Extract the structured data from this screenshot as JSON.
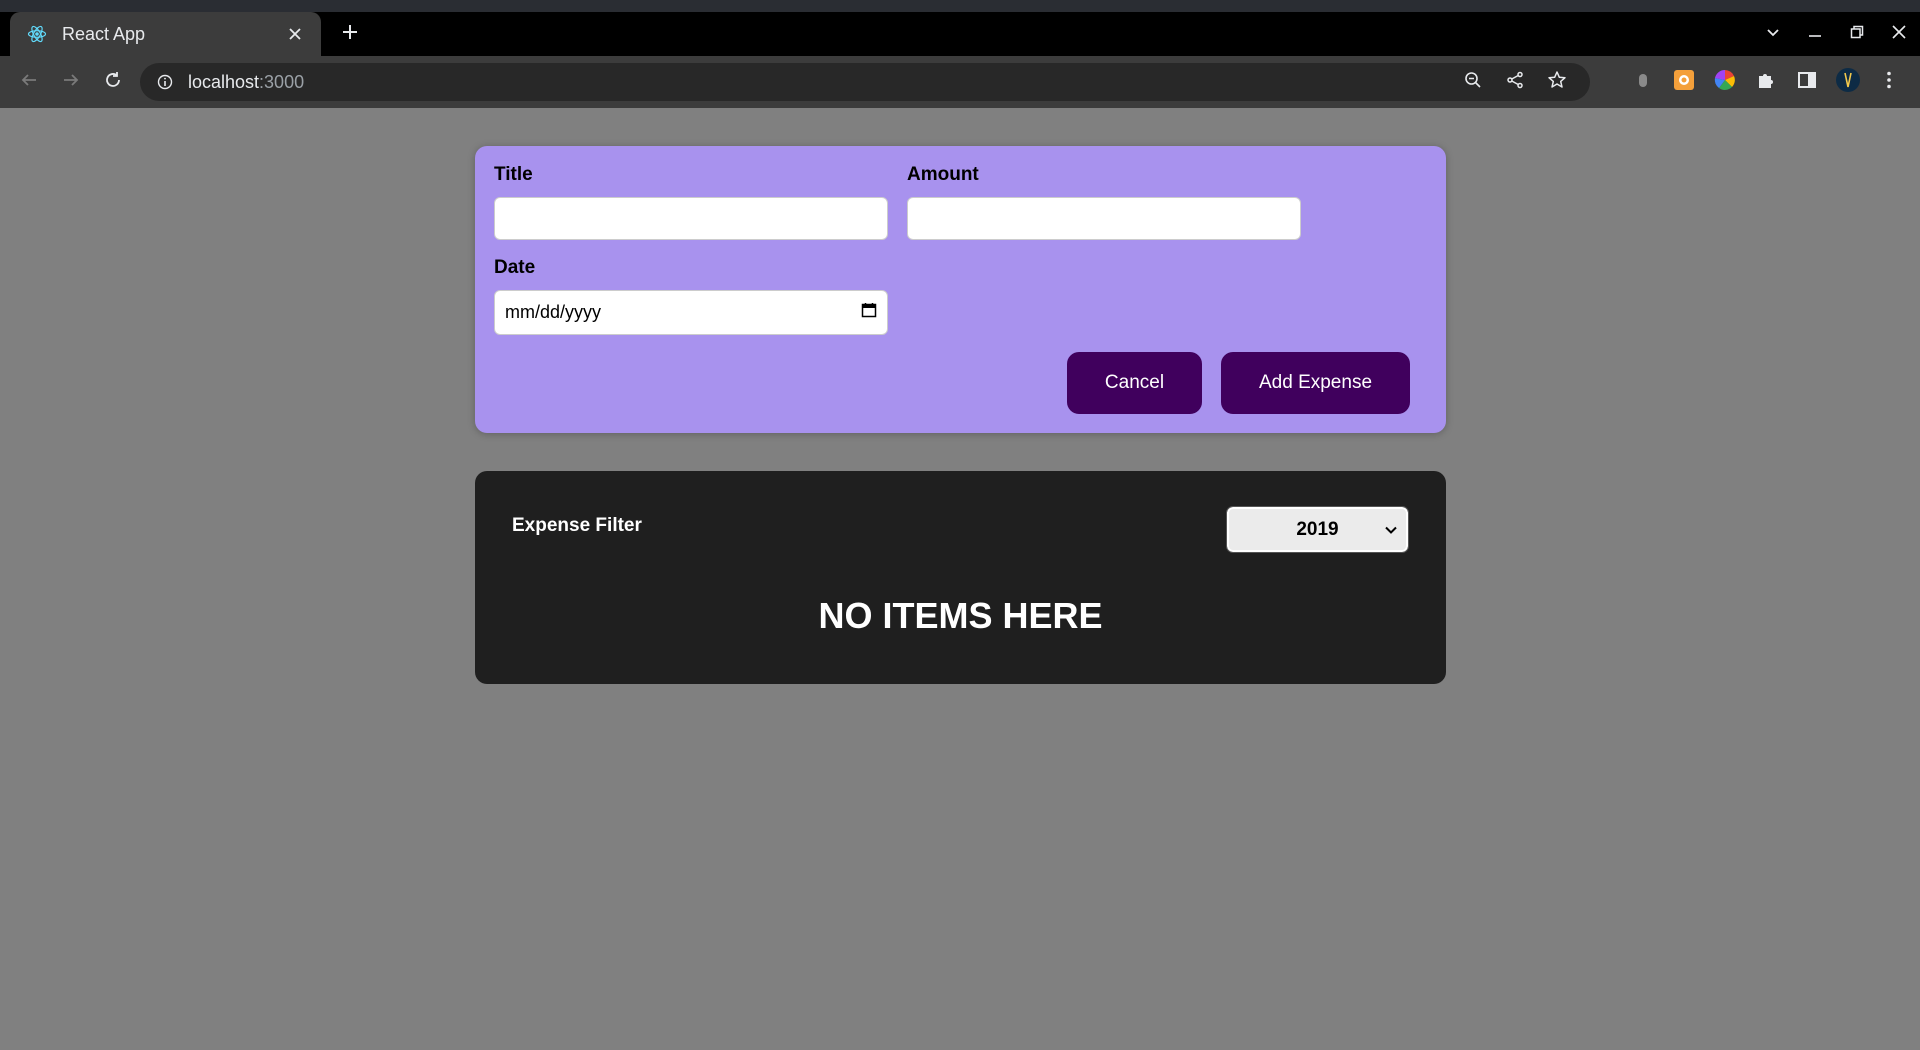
{
  "browser": {
    "tab_title": "React App",
    "url_host": "localhost",
    "url_port": ":3000",
    "icons": {
      "favicon": "react-logo-icon",
      "close": "close-icon",
      "new_tab": "plus-icon",
      "back": "arrow-left-icon",
      "forward": "arrow-right-icon",
      "reload": "reload-icon",
      "info": "info-icon",
      "zoom": "zoom-icon",
      "share": "share-icon",
      "bookmark": "star-icon",
      "extensions": "puzzle-icon",
      "menu": "kebab-menu-icon"
    }
  },
  "form": {
    "title_label": "Title",
    "title_value": "",
    "amount_label": "Amount",
    "amount_value": "",
    "date_label": "Date",
    "date_placeholder": "mm/dd/yyyy",
    "cancel_label": "Cancel",
    "submit_label": "Add Expense"
  },
  "expenses": {
    "filter_label": "Expense Filter",
    "selected_year": "2019",
    "empty_message": "NO ITEMS HERE"
  },
  "colors": {
    "form_bg": "#a892ee",
    "button_bg": "#40005d",
    "list_bg": "#1f1f1f",
    "page_bg": "#808080"
  }
}
